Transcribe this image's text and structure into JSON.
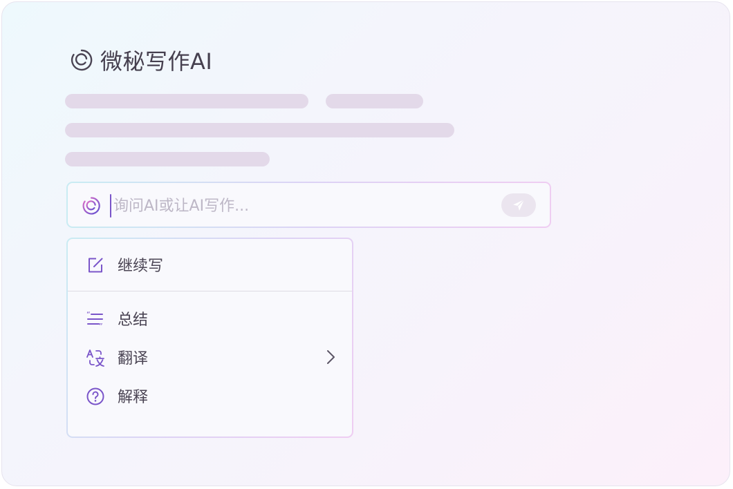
{
  "app": {
    "title": "微秘写作AI"
  },
  "input": {
    "placeholder": "询问AI或让AI写作..."
  },
  "menu": {
    "primary": {
      "label": "继续写",
      "icon": "edit-icon"
    },
    "items": [
      {
        "label": "总结",
        "icon": "quote-list-icon"
      },
      {
        "label": "翻译",
        "icon": "translate-icon",
        "has_submenu": true
      },
      {
        "label": "解释",
        "icon": "question-circle-icon"
      }
    ]
  },
  "colors": {
    "accent": "#7a55c9",
    "accent_pink": "#c06ad8",
    "text": "#4a4453",
    "skeleton": "#e3d9e9"
  }
}
